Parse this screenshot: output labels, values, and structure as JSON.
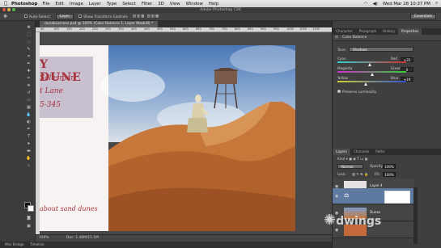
{
  "menubar": {
    "app": "Photoshop",
    "items": [
      "File",
      "Edit",
      "Image",
      "Layer",
      "Type",
      "Select",
      "Filter",
      "3D",
      "View",
      "Window",
      "Help"
    ],
    "clock": "Wed Mar 28  10:37 PM"
  },
  "window": {
    "title": "Adobe Photoshop CS6"
  },
  "options_bar": {
    "auto_select_label": "Auto-Select:",
    "auto_select_value": "Layer",
    "show_transform_label": "Show Transform Controls",
    "workspace": "Essentials"
  },
  "document": {
    "tab_label": "dunebusiness.psd @ 100% (Color Balance 1, Layer Mask/8) *",
    "ruler_marks": [
      "50",
      "100",
      "150",
      "200",
      "250",
      "300",
      "350",
      "400",
      "450",
      "500",
      "550",
      "600",
      "650",
      "700",
      "750",
      "800",
      "850",
      "900",
      "950",
      "1000",
      "1050",
      "1100"
    ],
    "status_zoom": "100%",
    "status_doc": "Doc: 1.48M/15.1M"
  },
  "artwork": {
    "title": "Y DUNE",
    "line2": "Salesman",
    "line3": "t Lane",
    "line4": "5-345",
    "tagline": "about sand dunes"
  },
  "bottom_tabs": [
    "Mini Bridge",
    "Timeline"
  ],
  "panels": {
    "top_tabs": [
      "Character",
      "Paragraph",
      "History",
      "Properties"
    ],
    "properties_title": "Color Balance",
    "tone_label": "Tone:",
    "tone_value": "Shadows",
    "sliders": [
      {
        "left": "Cyan",
        "right": "Red",
        "value": "+35",
        "thumb_pct": 0.47
      },
      {
        "left": "Magenta",
        "right": "Green",
        "value": "0",
        "thumb_pct": 0.5
      },
      {
        "left": "Yellow",
        "right": "Blue",
        "value": "+19",
        "thumb_pct": 0.41
      }
    ],
    "preserve_luminosity": "Preserve Luminosity",
    "layers_tabs": [
      "Layers",
      "Channels",
      "Paths"
    ],
    "kind_label": "Kind",
    "blend_mode": "Normal",
    "opacity_label": "Opacity:",
    "opacity_value": "100%",
    "lock_label": "Lock:",
    "fill_label": "Fill:",
    "fill_value": "100%",
    "layers": [
      {
        "name": "Layer 4"
      },
      {
        "name": ""
      },
      {
        "name": "Dunes"
      },
      {
        "name": ""
      }
    ]
  },
  "watermark": "lynda.com / ©dwings",
  "colors": {
    "accent_red": "#a8333d",
    "sky_top": "#4a77b6",
    "sand": "#c7773a"
  }
}
